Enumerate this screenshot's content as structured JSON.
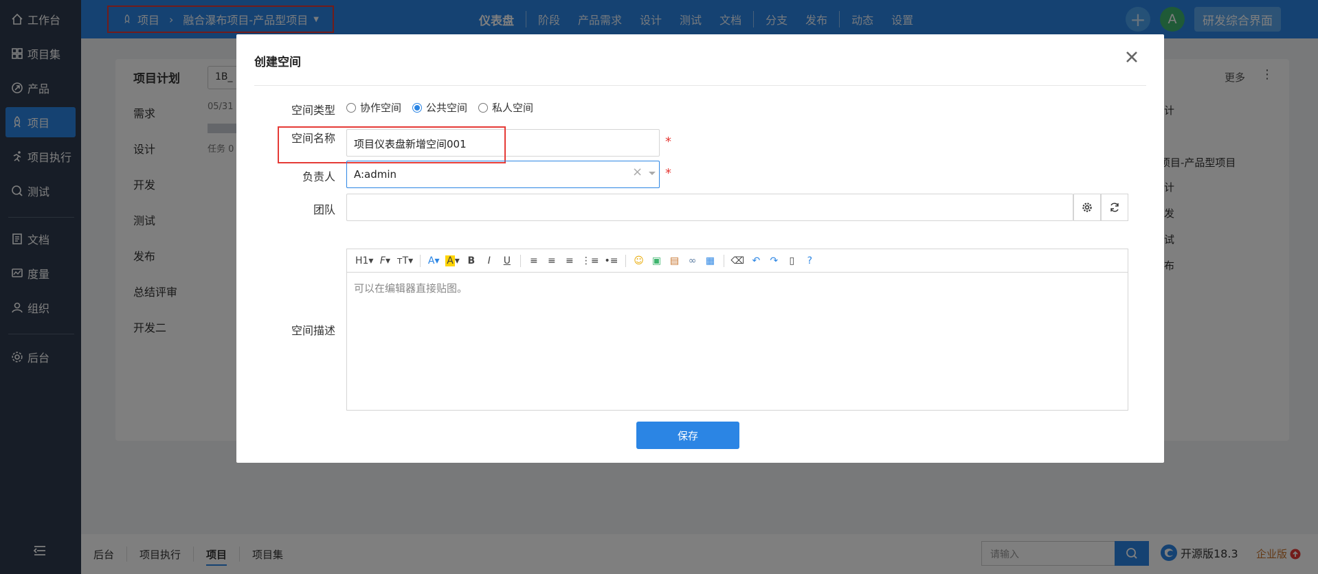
{
  "sidebar": {
    "items": [
      {
        "label": "工作台",
        "icon": "home-icon"
      },
      {
        "label": "项目集",
        "icon": "grid-icon"
      },
      {
        "label": "产品",
        "icon": "product-icon"
      },
      {
        "label": "项目",
        "icon": "rocket-icon"
      },
      {
        "label": "项目执行",
        "icon": "run-icon"
      },
      {
        "label": "测试",
        "icon": "search-icon"
      },
      {
        "label": "文档",
        "icon": "doc-icon"
      },
      {
        "label": "度量",
        "icon": "chart-icon"
      },
      {
        "label": "组织",
        "icon": "user-icon"
      },
      {
        "label": "后台",
        "icon": "gear-icon"
      }
    ]
  },
  "topbar": {
    "breadcrumb_root": "项目",
    "breadcrumb_current": "融合瀑布项目-产品型项目",
    "nav": [
      "仪表盘",
      "阶段",
      "产品需求",
      "设计",
      "测试",
      "文档",
      "分支",
      "发布",
      "动态",
      "设置"
    ],
    "avatar_letter": "A",
    "workspace_label": "研发综合界面"
  },
  "background": {
    "title": "项目计划",
    "select_value": "1B_",
    "date_text": "05/31",
    "task_text": "任务 0",
    "rows": [
      "需求",
      "设计",
      "开发",
      "测试",
      "发布",
      "总结评审",
      "开发二"
    ],
    "more": "更多",
    "right_items": [
      "计",
      "项目-产品型项目",
      "计",
      "发",
      "试",
      "布"
    ]
  },
  "modal": {
    "title": "创建空间",
    "space_type_label": "空间类型",
    "space_type_options": [
      "协作空间",
      "公共空间",
      "私人空间"
    ],
    "space_type_selected": "公共空间",
    "space_name_label": "空间名称",
    "space_name_value": "项目仪表盘新增空间001",
    "owner_label": "负责人",
    "owner_value": "A:admin",
    "team_label": "团队",
    "desc_label": "空间描述",
    "editor_placeholder": "可以在编辑器直接贴图。",
    "save_label": "保存",
    "required_mark": "*"
  },
  "bottombar": {
    "tabs": [
      "后台",
      "项目执行",
      "项目",
      "项目集"
    ],
    "active_tab": "项目",
    "search_placeholder": "请输入",
    "version": "开源版18.3",
    "enterprise": "企业版"
  },
  "colors": {
    "primary": "#2b85e4",
    "sidebar": "#2f3b4e",
    "highlight_box": "#e53935"
  }
}
